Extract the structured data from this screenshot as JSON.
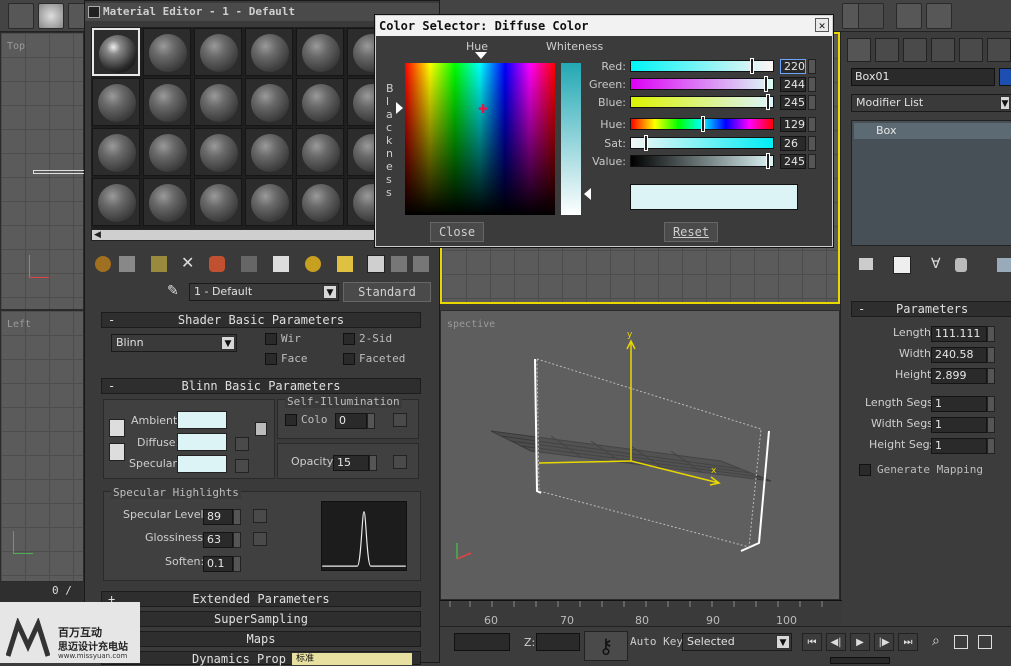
{
  "material_editor": {
    "title": "Material Editor - 1 - Default",
    "material_name": "1 - Default",
    "type_button": "Standard",
    "shader_rollout": "Shader Basic Parameters",
    "shader": "Blinn",
    "wire": "Wir",
    "two_sided": "2-Sid",
    "face": "Face",
    "faceted": "Faceted",
    "blinn_rollout": "Blinn Basic Parameters",
    "self_illum_group": "Self-Illumination",
    "color_label": "Colo",
    "self_illum_value": "0",
    "ambient": "Ambient:",
    "diffuse": "Diffuse:",
    "specular": "Specular:",
    "opacity_label": "Opacity:",
    "opacity_value": "15",
    "spec_group": "Specular Highlights",
    "spec_level_label": "Specular Level:",
    "spec_level": "89",
    "gloss_label": "Glossiness:",
    "gloss": "63",
    "soften_label": "Soften:",
    "soften": "0.1",
    "extended_rollout": "Extended Parameters",
    "supersampling_rollout": "SuperSampling",
    "maps_rollout": "Maps",
    "dynamics_rollout": "Dynamics Prop",
    "swatch_color": "#dcf4f5"
  },
  "color_selector": {
    "title": "Color Selector: Diffuse Color",
    "hue_label": "Hue",
    "whiteness_label": "Whiteness",
    "blackness_label": "B\nl\na\nc\nk\nn\ne\ns\ns",
    "red_label": "Red:",
    "red": "220",
    "green_label": "Green:",
    "green": "244",
    "blue_label": "Blue:",
    "blue": "245",
    "hue2_label": "Hue:",
    "hue": "129",
    "sat_label": "Sat:",
    "sat": "26",
    "value_label": "Value:",
    "value": "245",
    "close_button": "Close",
    "reset_button": "Reset",
    "preview_color": "#dcf4f5"
  },
  "viewports": {
    "top": "Top",
    "left": "Left",
    "perspective": "spective"
  },
  "command_panel": {
    "object_name": "Box01",
    "modifier_list": "Modifier List",
    "stack_item": "Box",
    "params_rollout": "Parameters",
    "length_label": "Length:",
    "length": "111.111",
    "width_label": "Width:",
    "width": "240.58",
    "height_label": "Height:",
    "height": "2.899",
    "length_segs_label": "Length Segs:",
    "length_segs": "1",
    "width_segs_label": "Width Segs:",
    "width_segs": "1",
    "height_segs_label": "Height Segs:",
    "height_segs": "1",
    "gen_mapping": "Generate Mapping"
  },
  "bottom": {
    "ruler_ticks": [
      "60",
      "70",
      "80",
      "90",
      "100"
    ],
    "left_counter": "0 /",
    "z_label": "Z:",
    "auto_key": "Auto Key",
    "selected": "Selected",
    "watermark_line1": "百万互动",
    "watermark_line2": "思迈设计充电站",
    "watermark_line3": "www.missyuan.com",
    "dyn_chars": "标准"
  }
}
